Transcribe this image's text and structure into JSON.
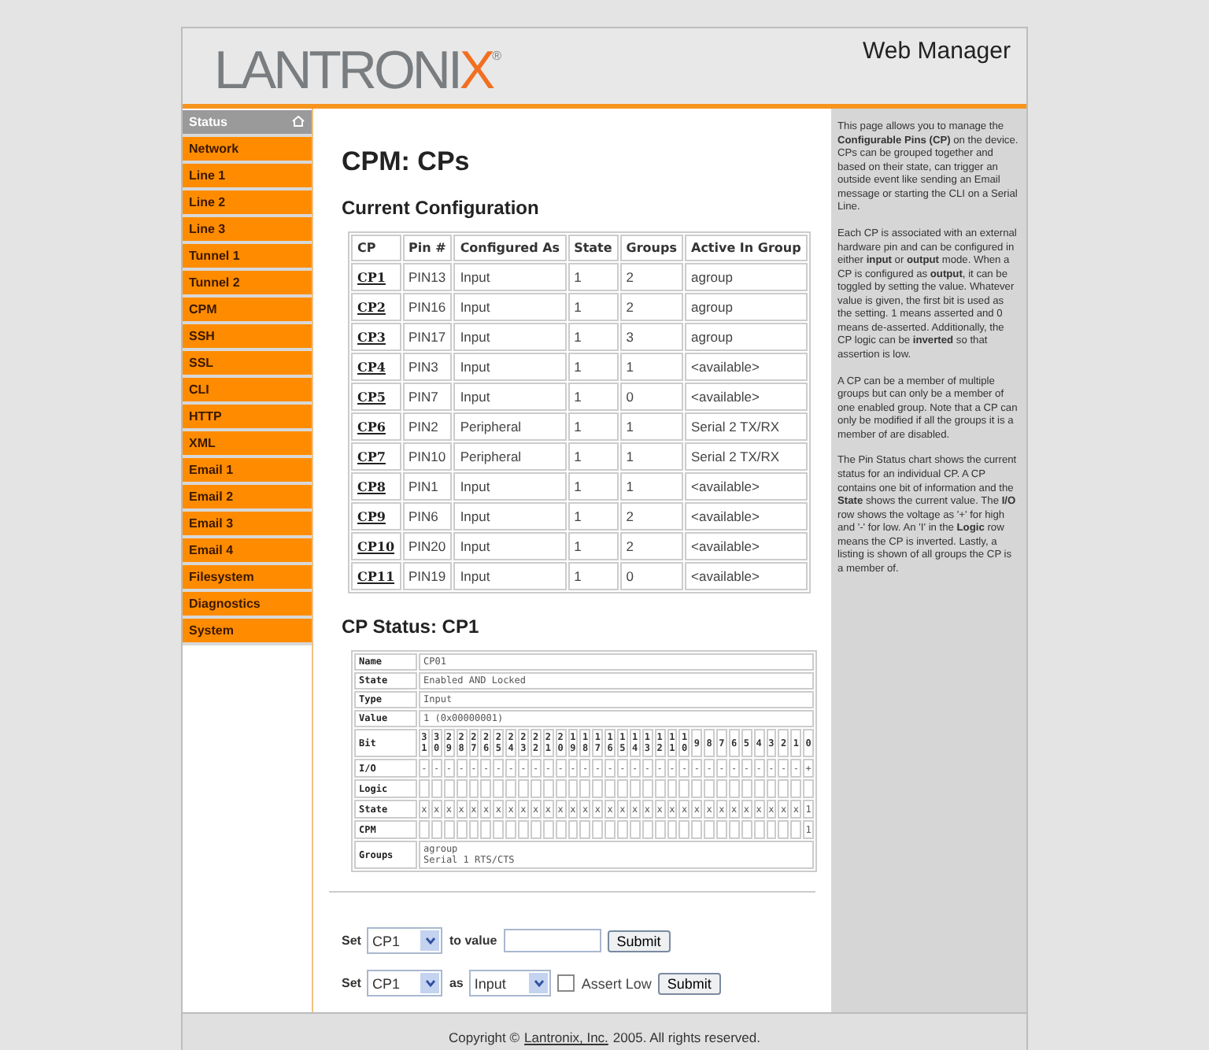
{
  "header": {
    "logo": {
      "text": "LANTRONI",
      "accent": "X",
      "mark": "®"
    },
    "title": "Web Manager"
  },
  "sidebar": {
    "items": [
      {
        "label": "Status",
        "kind": "home"
      },
      {
        "label": "Network",
        "kind": "link"
      },
      {
        "label": "Line 1",
        "kind": "link"
      },
      {
        "label": "Line 2",
        "kind": "link"
      },
      {
        "label": "Line 3",
        "kind": "link"
      },
      {
        "label": "Tunnel 1",
        "kind": "link"
      },
      {
        "label": "Tunnel 2",
        "kind": "link"
      },
      {
        "label": "CPM",
        "kind": "link"
      },
      {
        "label": "SSH",
        "kind": "link"
      },
      {
        "label": "SSL",
        "kind": "link"
      },
      {
        "label": "CLI",
        "kind": "link"
      },
      {
        "label": "HTTP",
        "kind": "link"
      },
      {
        "label": "XML",
        "kind": "link"
      },
      {
        "label": "Email 1",
        "kind": "link"
      },
      {
        "label": "Email 2",
        "kind": "link"
      },
      {
        "label": "Email 3",
        "kind": "link"
      },
      {
        "label": "Email 4",
        "kind": "link"
      },
      {
        "label": "Filesystem",
        "kind": "link"
      },
      {
        "label": "Diagnostics",
        "kind": "link"
      },
      {
        "label": "System",
        "kind": "link"
      }
    ]
  },
  "page_title": "CPM: CPs",
  "config": {
    "heading": "Current Configuration",
    "columns": [
      "CP",
      "Pin #",
      "Configured As",
      "State",
      "Groups",
      "Active In Group"
    ],
    "rows": [
      [
        "CP1",
        "PIN13",
        "Input",
        "1",
        "2",
        "agroup"
      ],
      [
        "CP2",
        "PIN16",
        "Input",
        "1",
        "2",
        "agroup"
      ],
      [
        "CP3",
        "PIN17",
        "Input",
        "1",
        "3",
        "agroup"
      ],
      [
        "CP4",
        "PIN3",
        "Input",
        "1",
        "1",
        "<available>"
      ],
      [
        "CP5",
        "PIN7",
        "Input",
        "1",
        "0",
        "<available>"
      ],
      [
        "CP6",
        "PIN2",
        "Peripheral",
        "1",
        "1",
        "Serial 2 TX/RX"
      ],
      [
        "CP7",
        "PIN10",
        "Peripheral",
        "1",
        "1",
        "Serial 2 TX/RX"
      ],
      [
        "CP8",
        "PIN1",
        "Input",
        "1",
        "1",
        "<available>"
      ],
      [
        "CP9",
        "PIN6",
        "Input",
        "1",
        "2",
        "<available>"
      ],
      [
        "CP10",
        "PIN20",
        "Input",
        "1",
        "2",
        "<available>"
      ],
      [
        "CP11",
        "PIN19",
        "Input",
        "1",
        "0",
        "<available>"
      ]
    ]
  },
  "status": {
    "heading": "CP Status: CP1",
    "fields": [
      {
        "label": "Name",
        "value": "CP01"
      },
      {
        "label": "State",
        "value": "Enabled AND Locked"
      },
      {
        "label": "Type",
        "value": "Input"
      },
      {
        "label": "Value",
        "value": "1 (0x00000001)"
      }
    ],
    "bits": {
      "label": "Bit",
      "cells": [
        "31",
        "30",
        "29",
        "28",
        "27",
        "26",
        "25",
        "24",
        "23",
        "22",
        "21",
        "20",
        "19",
        "18",
        "17",
        "16",
        "15",
        "14",
        "13",
        "12",
        "11",
        "10",
        "9",
        "8",
        "7",
        "6",
        "5",
        "4",
        "3",
        "2",
        "1",
        "0"
      ]
    },
    "rows": [
      {
        "label": "I/O",
        "cells": [
          "-",
          "-",
          "-",
          "-",
          "-",
          "-",
          "-",
          "-",
          "-",
          "-",
          "-",
          "-",
          "-",
          "-",
          "-",
          "-",
          "-",
          "-",
          "-",
          "-",
          "-",
          "-",
          "-",
          "-",
          "-",
          "-",
          "-",
          "-",
          "-",
          "-",
          "-",
          "+"
        ]
      },
      {
        "label": "Logic"
      },
      {
        "label": "State",
        "cells": [
          "x",
          "x",
          "x",
          "x",
          "x",
          "x",
          "x",
          "x",
          "x",
          "x",
          "x",
          "x",
          "x",
          "x",
          "x",
          "x",
          "x",
          "x",
          "x",
          "x",
          "x",
          "x",
          "x",
          "x",
          "x",
          "x",
          "x",
          "x",
          "x",
          "x",
          "x",
          "1"
        ]
      },
      {
        "label": "CPM",
        "cells": [
          null,
          null,
          null,
          null,
          null,
          null,
          null,
          null,
          null,
          null,
          null,
          null,
          null,
          null,
          null,
          null,
          null,
          null,
          null,
          null,
          null,
          null,
          null,
          null,
          null,
          null,
          null,
          null,
          null,
          null,
          null,
          "1"
        ]
      }
    ],
    "groups": {
      "label": "Groups",
      "lines": [
        "agroup",
        "Serial 1 RTS/CTS"
      ]
    }
  },
  "forms": [
    {
      "set": "Set",
      "cp": "CP1",
      "to": "to value",
      "button": "Submit"
    },
    {
      "set": "Set",
      "cp": "CP1",
      "as": "as",
      "mode": "Input",
      "assert": {
        "label": "Assert Low",
        "checked": false
      },
      "button": "Submit"
    }
  ],
  "help": [
    "This page allows you to manage the **Configurable Pins (CP)** on the device. CPs can be grouped together and based on their state, can trigger an outside event like sending an Email message or starting the CLI on a Serial Line.",
    "Each CP is associated with an external hardware pin and can be configured in either **input** or **output** mode. When a CP is configured as **output**, it can be toggled by setting the value. Whatever value is given, the first bit is used as the setting. 1 means asserted and 0 means de-asserted. Additionally, the CP logic can be **inverted** so that assertion is low.",
    "A CP can be a member of multiple groups but can only be a member of one enabled group. Note that a CP can only be modified if all the groups it is a member of are disabled.",
    "The Pin Status chart shows the current status for an individual CP. A CP contains one bit of information and the **State** shows the current value. The **I/O** row shows the voltage as '+' for high and '-' for low. An 'I' in the **Logic** row means the CP is inverted. Lastly, a listing is shown of all groups the CP is a member of."
  ],
  "footer": {
    "before": "Copyright ©",
    "link": "Lantronix, Inc.",
    "after": "2005. All rights reserved."
  }
}
